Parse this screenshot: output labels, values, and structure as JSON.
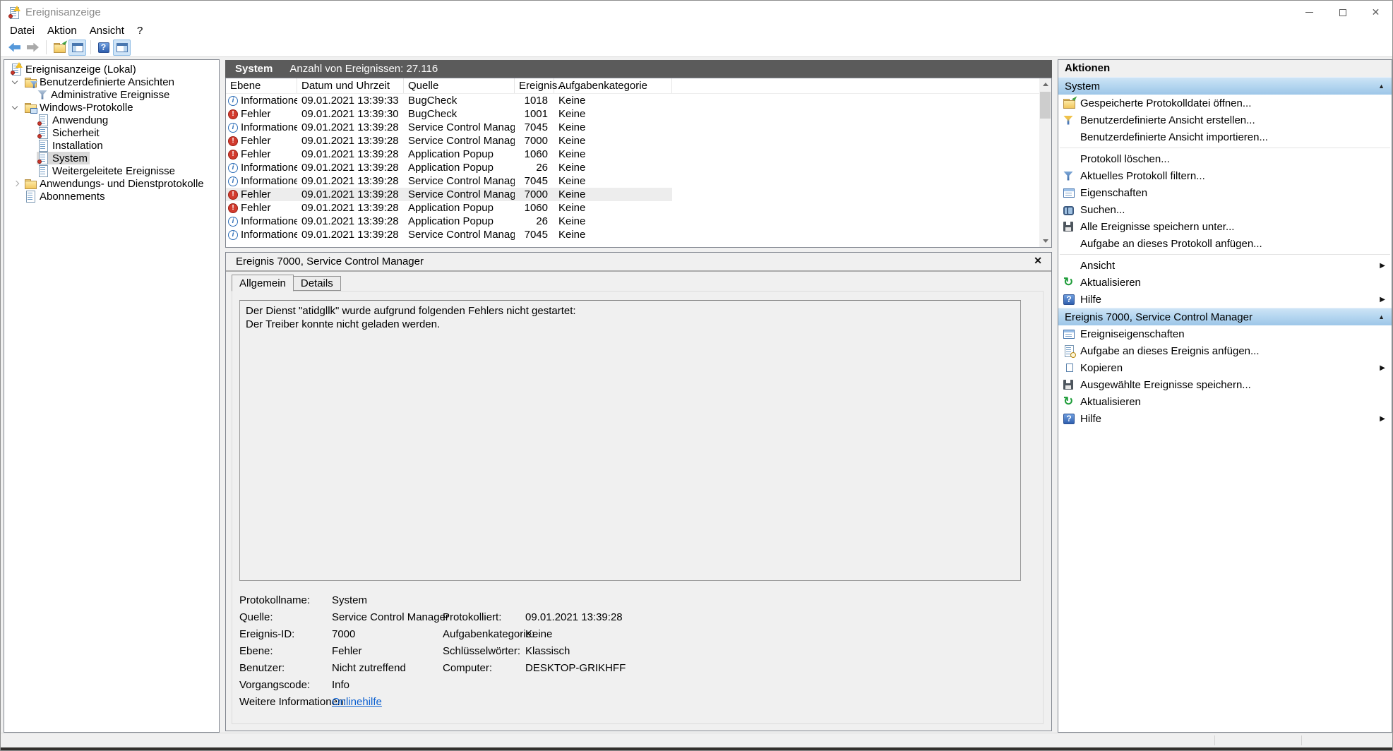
{
  "window": {
    "title": "Ereignisanzeige"
  },
  "icons": {
    "close_window": "✕",
    "detail_close": "✕",
    "info_glyph": "i",
    "error_glyph": "!",
    "collapse": "▲",
    "submenu": "▶",
    "help_glyph": "?",
    "refresh_glyph": "↻"
  },
  "menu": {
    "items": [
      "Datei",
      "Aktion",
      "Ansicht",
      "?"
    ]
  },
  "toolbar": {
    "buttons": [
      "back",
      "forward",
      "open-saved-log",
      "toggle-console-tree",
      "help",
      "toggle-action-pane"
    ]
  },
  "tree": {
    "items": [
      {
        "label": "Ereignisanzeige (Lokal)",
        "icon": "event-viewer-icon",
        "level": 0
      },
      {
        "label": "Benutzerdefinierte Ansichten",
        "icon": "custom-views-folder-icon",
        "level": 1,
        "expanded": true
      },
      {
        "label": "Administrative Ereignisse",
        "icon": "filter-icon",
        "level": 2
      },
      {
        "label": "Windows-Protokolle",
        "icon": "windows-logs-folder-icon",
        "level": 1,
        "expanded": true
      },
      {
        "label": "Anwendung",
        "icon": "log-icon",
        "level": 2
      },
      {
        "label": "Sicherheit",
        "icon": "log-icon",
        "level": 2
      },
      {
        "label": "Installation",
        "icon": "document-icon",
        "level": 2
      },
      {
        "label": "System",
        "icon": "log-icon",
        "level": 2,
        "selected": true
      },
      {
        "label": "Weitergeleitete Ereignisse",
        "icon": "document-icon",
        "level": 2
      },
      {
        "label": "Anwendungs- und Dienstprotokolle",
        "icon": "folder-icon",
        "level": 1,
        "expanded": false
      },
      {
        "label": "Abonnements",
        "icon": "document-icon",
        "level": 1
      }
    ]
  },
  "events_panel": {
    "caption_title": "System",
    "caption_count": "Anzahl von Ereignissen: 27.116",
    "columns": [
      "Ebene",
      "Datum und Uhrzeit",
      "Quelle",
      "Ereignis...",
      "Aufgabenkategorie"
    ],
    "rows": [
      {
        "icon": "info-icon",
        "level": "Informationen",
        "datetime": "09.01.2021 13:39:33",
        "source": "BugCheck",
        "event_id": "1018",
        "category": "Keine"
      },
      {
        "icon": "error-icon",
        "level": "Fehler",
        "datetime": "09.01.2021 13:39:30",
        "source": "BugCheck",
        "event_id": "1001",
        "category": "Keine"
      },
      {
        "icon": "info-icon",
        "level": "Informationen",
        "datetime": "09.01.2021 13:39:28",
        "source": "Service Control Manager",
        "event_id": "7045",
        "category": "Keine"
      },
      {
        "icon": "error-icon",
        "level": "Fehler",
        "datetime": "09.01.2021 13:39:28",
        "source": "Service Control Manager",
        "event_id": "7000",
        "category": "Keine"
      },
      {
        "icon": "error-icon",
        "level": "Fehler",
        "datetime": "09.01.2021 13:39:28",
        "source": "Application Popup",
        "event_id": "1060",
        "category": "Keine"
      },
      {
        "icon": "info-icon",
        "level": "Informationen",
        "datetime": "09.01.2021 13:39:28",
        "source": "Application Popup",
        "event_id": "26",
        "category": "Keine"
      },
      {
        "icon": "info-icon",
        "level": "Informationen",
        "datetime": "09.01.2021 13:39:28",
        "source": "Service Control Manager",
        "event_id": "7045",
        "category": "Keine"
      },
      {
        "icon": "error-icon",
        "level": "Fehler",
        "datetime": "09.01.2021 13:39:28",
        "source": "Service Control Manager",
        "event_id": "7000",
        "category": "Keine",
        "selected": true
      },
      {
        "icon": "error-icon",
        "level": "Fehler",
        "datetime": "09.01.2021 13:39:28",
        "source": "Application Popup",
        "event_id": "1060",
        "category": "Keine"
      },
      {
        "icon": "info-icon",
        "level": "Informationen",
        "datetime": "09.01.2021 13:39:28",
        "source": "Application Popup",
        "event_id": "26",
        "category": "Keine"
      },
      {
        "icon": "info-icon",
        "level": "Informationen",
        "datetime": "09.01.2021 13:39:28",
        "source": "Service Control Manager",
        "event_id": "7045",
        "category": "Keine"
      }
    ]
  },
  "detail": {
    "header": "Ereignis 7000, Service Control Manager",
    "tabs": [
      "Allgemein",
      "Details"
    ],
    "description": [
      "Der Dienst \"atidgllk\" wurde aufgrund folgenden Fehlers nicht gestartet:",
      "Der Treiber konnte nicht geladen werden."
    ],
    "properties": {
      "rows": [
        {
          "l1": "Protokollname:",
          "v1": "System",
          "l2": "",
          "v2": ""
        },
        {
          "l1": "Quelle:",
          "v1": "Service Control Manager",
          "l2": "Protokolliert:",
          "v2": "09.01.2021 13:39:28"
        },
        {
          "l1": "Ereignis-ID:",
          "v1": "7000",
          "l2": "Aufgabenkategorie:",
          "v2": "Keine"
        },
        {
          "l1": "Ebene:",
          "v1": "Fehler",
          "l2": "Schlüsselwörter:",
          "v2": "Klassisch"
        },
        {
          "l1": "Benutzer:",
          "v1": "Nicht zutreffend",
          "l2": "Computer:",
          "v2": "DESKTOP-GRIKHFF"
        },
        {
          "l1": "Vorgangscode:",
          "v1": "Info",
          "l2": "",
          "v2": ""
        },
        {
          "l1": "Weitere Informationen:",
          "v1": "Onlinehilfe",
          "l2": "",
          "v2": ""
        }
      ]
    }
  },
  "actions": {
    "title": "Aktionen",
    "sections": [
      {
        "header": "System",
        "items": [
          {
            "icon": "open-folder-icon",
            "label": "Gespeicherte Protokolldatei öffnen..."
          },
          {
            "icon": "create-filter-icon",
            "label": "Benutzerdefinierte Ansicht erstellen..."
          },
          {
            "icon": "",
            "label": "Benutzerdefinierte Ansicht importieren..."
          },
          {
            "icon": "",
            "label": "Protokoll löschen..."
          },
          {
            "icon": "filter-icon",
            "label": "Aktuelles Protokoll filtern..."
          },
          {
            "icon": "properties-icon",
            "label": "Eigenschaften"
          },
          {
            "icon": "find-icon",
            "label": "Suchen..."
          },
          {
            "icon": "save-icon",
            "label": "Alle Ereignisse speichern unter..."
          },
          {
            "icon": "",
            "label": "Aufgabe an dieses Protokoll anfügen..."
          },
          {
            "icon": "",
            "label": "Ansicht",
            "submenu": true
          },
          {
            "icon": "refresh-icon",
            "label": "Aktualisieren"
          },
          {
            "icon": "help-icon",
            "label": "Hilfe",
            "submenu": true
          }
        ]
      },
      {
        "header": "Ereignis 7000, Service Control Manager",
        "items": [
          {
            "icon": "properties-icon",
            "label": "Ereigniseigenschaften"
          },
          {
            "icon": "task-icon",
            "label": "Aufgabe an dieses Ereignis anfügen..."
          },
          {
            "icon": "copy-icon",
            "label": "Kopieren",
            "submenu": true
          },
          {
            "icon": "save-icon",
            "label": "Ausgewählte Ereignisse speichern..."
          },
          {
            "icon": "refresh-icon",
            "label": "Aktualisieren"
          },
          {
            "icon": "help-icon",
            "label": "Hilfe",
            "submenu": true
          }
        ]
      }
    ]
  }
}
